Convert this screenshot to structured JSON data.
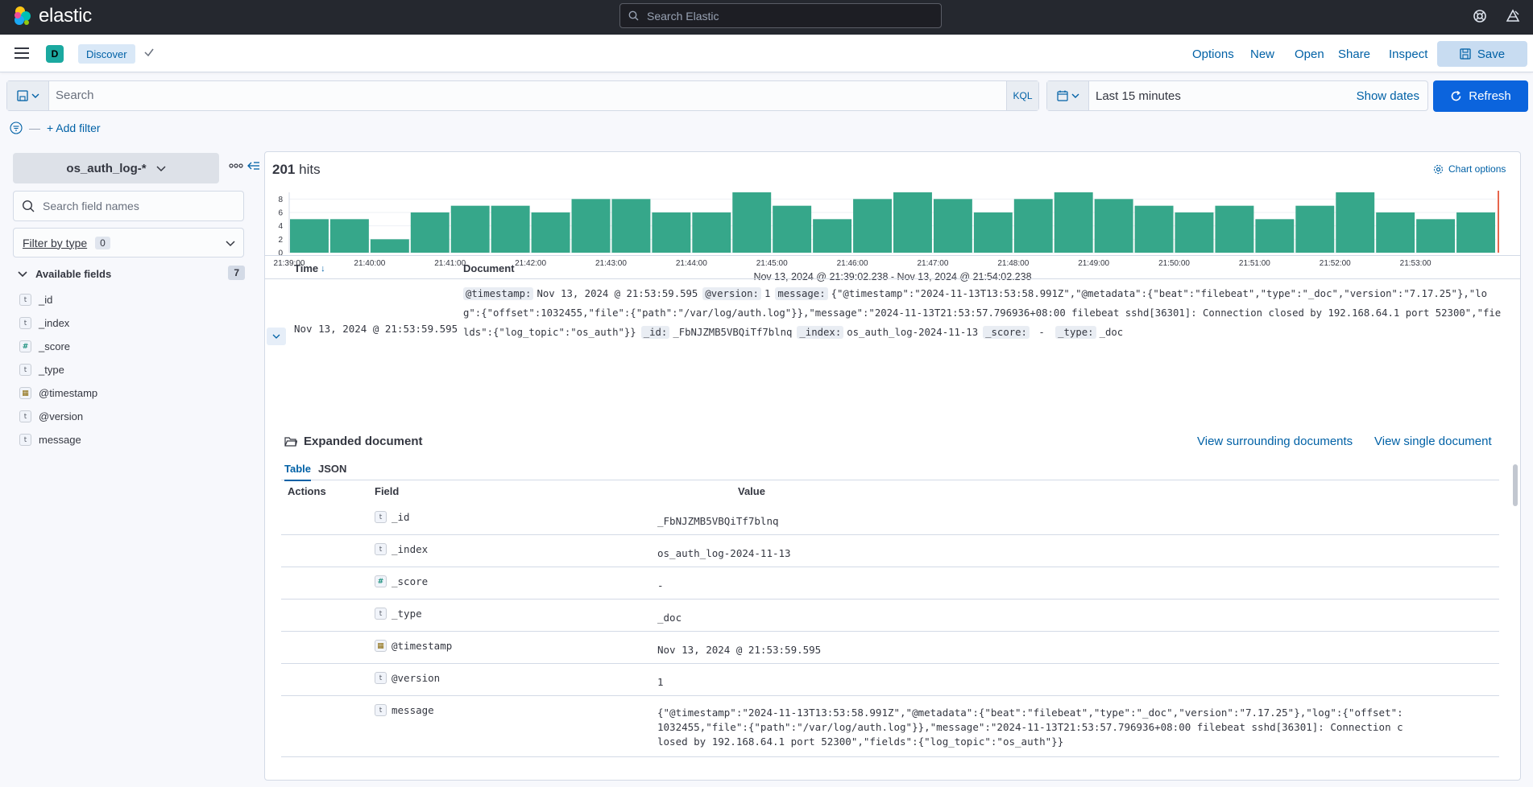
{
  "header": {
    "brand": "elastic",
    "search_placeholder": "Search Elastic"
  },
  "app_bar": {
    "space_initial": "D",
    "breadcrumb": "Discover",
    "links": [
      "Options",
      "New",
      "Open",
      "Share",
      "Inspect"
    ],
    "save_label": "Save"
  },
  "query": {
    "placeholder": "Search",
    "language": "KQL",
    "date_range": "Last 15 minutes",
    "show_dates": "Show dates",
    "refresh_label": "Refresh",
    "add_filter": "+ Add filter"
  },
  "sidebar": {
    "index_pattern": "os_auth_log-*",
    "field_search_placeholder": "Search field names",
    "filter_by_type": "Filter by type",
    "filter_count": "0",
    "available_fields_label": "Available fields",
    "available_count": "7",
    "fields": [
      {
        "name": "_id",
        "type": "t"
      },
      {
        "name": "_index",
        "type": "t"
      },
      {
        "name": "_score",
        "type": "#"
      },
      {
        "name": "_type",
        "type": "t"
      },
      {
        "name": "@timestamp",
        "type": "date"
      },
      {
        "name": "@version",
        "type": "t"
      },
      {
        "name": "message",
        "type": "t"
      }
    ]
  },
  "results": {
    "hits_number": "201",
    "hits_label": "hits",
    "chart_options": "Chart options",
    "time_range_caption": "Nov 13, 2024 @ 21:39:02.238 - Nov 13, 2024 @ 21:54:02.238",
    "col_time": "Time",
    "col_document": "Document",
    "row": {
      "time": "Nov 13, 2024 @ 21:53:59.595",
      "pairs": [
        {
          "key": "@timestamp:",
          "value": "Nov 13, 2024 @ 21:53:59.595"
        },
        {
          "key": "@version:",
          "value": "1"
        },
        {
          "key": "message:",
          "value": "{\"@timestamp\":\"2024-11-13T13:53:58.991Z\",\"@metadata\":{\"beat\":\"filebeat\",\"type\":\"_doc\",\"version\":\"7.17.25\"},\"log\":{\"offset\":1032455,\"file\":{\"path\":\"/var/log/auth.log\"}},\"message\":\"2024-11-13T21:53:57.796936+08:00 filebeat sshd[36301]: Connection closed by 192.168.64.1 port 52300\",\"fields\":{\"log_topic\":\"os_auth\"}}"
        },
        {
          "key": "_id:",
          "value": "_FbNJZMB5VBQiTf7blnq"
        },
        {
          "key": "_index:",
          "value": "os_auth_log-2024-11-13"
        },
        {
          "key": "_score:",
          "value": " - "
        },
        {
          "key": "_type:",
          "value": "_doc"
        }
      ]
    }
  },
  "expanded": {
    "title": "Expanded document",
    "view_surrounding": "View surrounding documents",
    "view_single": "View single document",
    "tabs": [
      "Table",
      "JSON"
    ],
    "headers": [
      "Actions",
      "Field",
      "Value"
    ],
    "rows": [
      {
        "field": "_id",
        "type": "t",
        "value": "_FbNJZMB5VBQiTf7blnq"
      },
      {
        "field": "_index",
        "type": "t",
        "value": "os_auth_log-2024-11-13"
      },
      {
        "field": "_score",
        "type": "#",
        "value": " -"
      },
      {
        "field": "_type",
        "type": "t",
        "value": "_doc"
      },
      {
        "field": "@timestamp",
        "type": "date",
        "value": "Nov 13, 2024 @ 21:53:59.595"
      },
      {
        "field": "@version",
        "type": "t",
        "value": "1"
      },
      {
        "field": "message",
        "type": "t",
        "value": "{\"@timestamp\":\"2024-11-13T13:53:58.991Z\",\"@metadata\":{\"beat\":\"filebeat\",\"type\":\"_doc\",\"version\":\"7.17.25\"},\"log\":{\"offset\":1032455,\"file\":{\"path\":\"/var/log/auth.log\"}},\"message\":\"2024-11-13T21:53:57.796936+08:00 filebeat sshd[36301]: Connection closed by 192.168.64.1 port 52300\",\"fields\":{\"log_topic\":\"os_auth\"}}"
      }
    ]
  },
  "chart_data": {
    "type": "bar",
    "categories": [
      "21:39:00",
      "21:39:30",
      "21:40:00",
      "21:40:30",
      "21:41:00",
      "21:41:30",
      "21:42:00",
      "21:42:30",
      "21:43:00",
      "21:43:30",
      "21:44:00",
      "21:44:30",
      "21:45:00",
      "21:45:30",
      "21:46:00",
      "21:46:30",
      "21:47:00",
      "21:47:30",
      "21:48:00",
      "21:48:30",
      "21:49:00",
      "21:49:30",
      "21:50:00",
      "21:50:30",
      "21:51:00",
      "21:51:30",
      "21:52:00",
      "21:52:30",
      "21:53:00",
      "21:53:30"
    ],
    "values": [
      5,
      5,
      2,
      6,
      7,
      7,
      6,
      8,
      8,
      6,
      6,
      9,
      7,
      5,
      8,
      9,
      8,
      6,
      8,
      9,
      8,
      7,
      6,
      7,
      5,
      7,
      9,
      6,
      5,
      6
    ],
    "x_tick_labels": [
      "21:39:00",
      "21:40:00",
      "21:41:00",
      "21:42:00",
      "21:43:00",
      "21:44:00",
      "21:45:00",
      "21:46:00",
      "21:47:00",
      "21:48:00",
      "21:49:00",
      "21:50:00",
      "21:51:00",
      "21:52:00",
      "21:53:00"
    ],
    "y_ticks": [
      0,
      2,
      4,
      6,
      8
    ],
    "ylim": [
      0,
      9
    ],
    "bar_color": "#36a78a",
    "now_marker_color": "#e7664c"
  }
}
